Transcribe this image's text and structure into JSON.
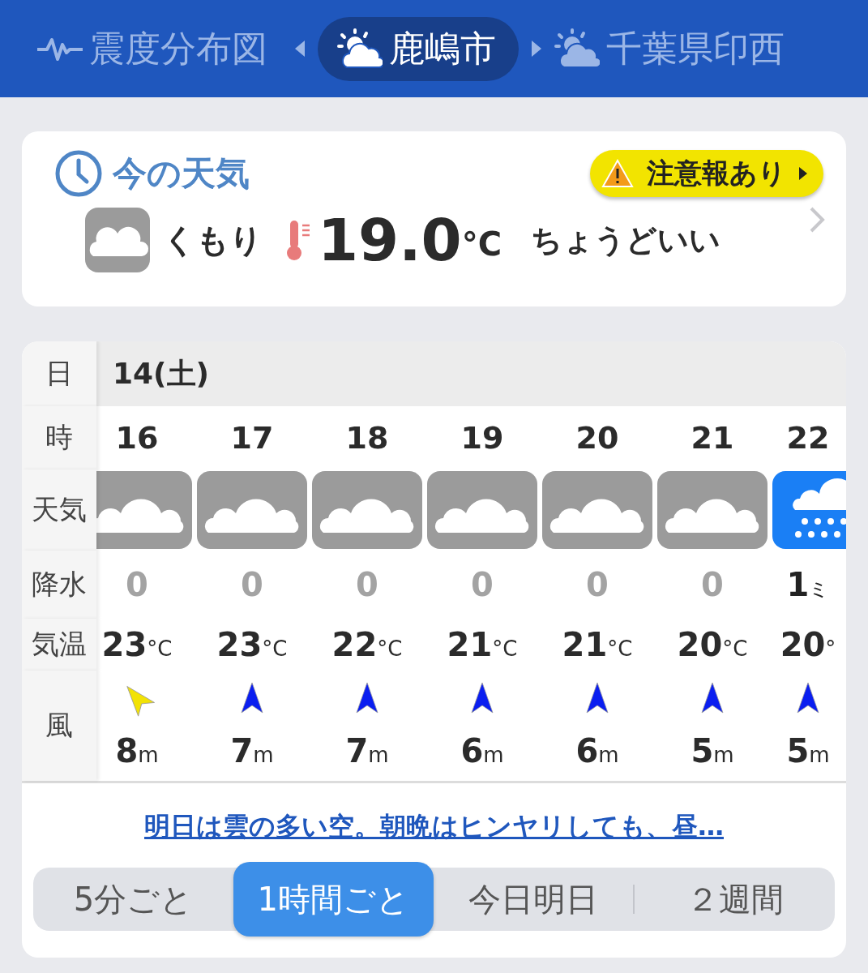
{
  "header_tabs": [
    {
      "kind": "quake",
      "label": "震度分布図",
      "selected": false
    },
    {
      "kind": "city",
      "label": "鹿嶋市",
      "selected": true
    },
    {
      "kind": "city",
      "label": "千葉県印西",
      "selected": false
    }
  ],
  "current": {
    "title": "今の天気",
    "alert": "注意報あり",
    "icon": {
      "kind": "cloudy"
    },
    "condition": "くもり",
    "temperature": "19.0",
    "temp_unit": "°C",
    "feeling": "ちょうどいい"
  },
  "forecast": {
    "labels": {
      "day": "日",
      "hour": "時",
      "weather": "天気",
      "precip": "降水",
      "temp": "気温",
      "wind": "風"
    },
    "date": "14(土)",
    "hours": [
      {
        "hour": "16",
        "weather": {
          "kind": "cloudy"
        },
        "precip": "0",
        "rainy": false,
        "temp": "23",
        "temp_unit": "°C",
        "wind_arrow": {
          "kind": "northwest",
          "color": "#f2e205"
        },
        "wind": "8",
        "wind_unit": "m"
      },
      {
        "hour": "17",
        "weather": {
          "kind": "cloudy"
        },
        "precip": "0",
        "rainy": false,
        "temp": "23",
        "temp_unit": "°C",
        "wind_arrow": {
          "kind": "north",
          "color": "#0a1ef0"
        },
        "wind": "7",
        "wind_unit": "m"
      },
      {
        "hour": "18",
        "weather": {
          "kind": "cloudy"
        },
        "precip": "0",
        "rainy": false,
        "temp": "22",
        "temp_unit": "°C",
        "wind_arrow": {
          "kind": "north",
          "color": "#0a1ef0"
        },
        "wind": "7",
        "wind_unit": "m"
      },
      {
        "hour": "19",
        "weather": {
          "kind": "cloudy"
        },
        "precip": "0",
        "rainy": false,
        "temp": "21",
        "temp_unit": "°C",
        "wind_arrow": {
          "kind": "north",
          "color": "#0a1ef0"
        },
        "wind": "6",
        "wind_unit": "m"
      },
      {
        "hour": "20",
        "weather": {
          "kind": "cloudy"
        },
        "precip": "0",
        "rainy": false,
        "temp": "21",
        "temp_unit": "°C",
        "wind_arrow": {
          "kind": "north",
          "color": "#0a1ef0"
        },
        "wind": "6",
        "wind_unit": "m"
      },
      {
        "hour": "21",
        "weather": {
          "kind": "cloudy"
        },
        "precip": "0",
        "rainy": false,
        "temp": "20",
        "temp_unit": "°C",
        "wind_arrow": {
          "kind": "north",
          "color": "#0a1ef0"
        },
        "wind": "5",
        "wind_unit": "m"
      },
      {
        "hour": "22",
        "weather": {
          "kind": "rain"
        },
        "precip": "1",
        "precip_unit": "ミ",
        "rainy": true,
        "temp": "20",
        "temp_unit": "°",
        "wind_arrow": {
          "kind": "north",
          "color": "#0a1ef0"
        },
        "wind": "5",
        "wind_unit": "m"
      }
    ],
    "summary_link": "明日は雲の多い空。朝晩はヒンヤリしても、昼…"
  },
  "range_tabs": [
    {
      "label": "5分ごと",
      "selected": false
    },
    {
      "label": "1時間ごと",
      "selected": true
    },
    {
      "label": "今日明日",
      "selected": false
    },
    {
      "label": "２週間",
      "selected": false
    }
  ]
}
